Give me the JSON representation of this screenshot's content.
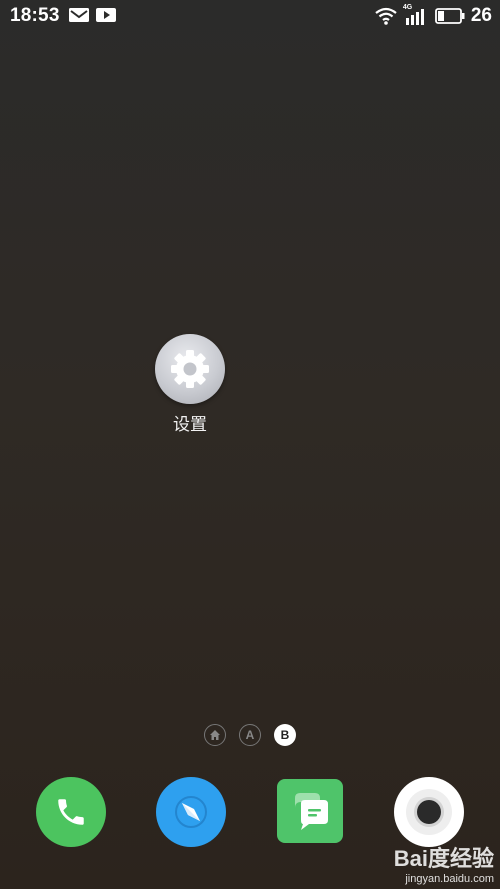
{
  "status_bar": {
    "time": "18:53",
    "battery_level": "26",
    "network_type": "4G",
    "icons": [
      "mail-icon",
      "play-icon",
      "wifi-icon",
      "signal-icon",
      "battery-icon"
    ]
  },
  "home": {
    "apps": [
      {
        "label": "设置",
        "icon": "settings-gear-icon"
      }
    ]
  },
  "page_indicator": {
    "pages": [
      {
        "label": "",
        "icon": "home-icon",
        "active": false
      },
      {
        "label": "A",
        "active": false
      },
      {
        "label": "B",
        "active": true
      }
    ]
  },
  "dock": {
    "apps": [
      {
        "icon": "phone-icon",
        "color": "#4cc45f"
      },
      {
        "icon": "compass-browser-icon",
        "color": "#2ea0ef"
      },
      {
        "icon": "messages-icon",
        "color": "#4fc46a"
      },
      {
        "icon": "camera-icon",
        "color": "#ffffff"
      }
    ]
  },
  "watermark": {
    "brand": "Bai度经验",
    "url": "jingyan.baidu.com"
  }
}
